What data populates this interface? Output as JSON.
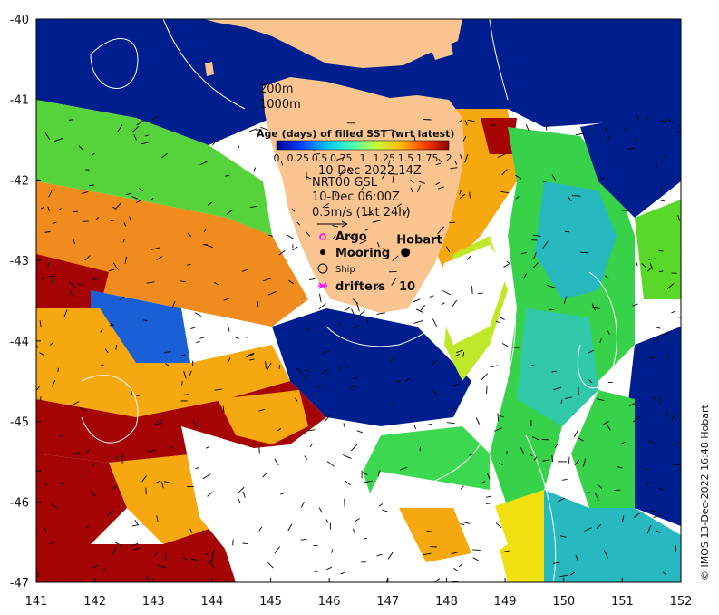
{
  "map": {
    "lon_min": 141,
    "lon_max": 152,
    "lat_min": -47,
    "lat_max": -40,
    "x_ticks": [
      141,
      142,
      143,
      144,
      145,
      146,
      147,
      148,
      149,
      150,
      151,
      152
    ],
    "x_tick_labels": [
      "141",
      "142",
      "143",
      "144",
      "145",
      "146",
      "147",
      "148",
      "149",
      "150",
      "151",
      "152"
    ],
    "y_ticks": [
      -40,
      -41,
      -42,
      -43,
      -44,
      -45,
      -46,
      -47
    ],
    "y_tick_labels": [
      "-40",
      "-41",
      "-42",
      "-43",
      "-44",
      "-45",
      "-46",
      "-47"
    ],
    "land_color": "#f9c48f",
    "ocean_nodata_color": "#ffffff"
  },
  "isobath_labels": {
    "a": "200m",
    "b": "1000m"
  },
  "colorbar": {
    "title": "Age (days) of filled SST (wrt latest)",
    "tick_labels": [
      "0",
      "0.25",
      "0.5",
      "0.75",
      "1",
      "1.25",
      "1.5",
      "1.75",
      "2"
    ],
    "range": [
      0,
      2
    ],
    "colors": [
      "#00008f",
      "#0040ff",
      "#00bfff",
      "#40ffbf",
      "#bfff40",
      "#ffbf00",
      "#ff4000",
      "#8f0000"
    ]
  },
  "info": {
    "date": "10-Dec-2022 14Z",
    "product": "NRT00 GSL",
    "current_time": "10-Dec 06:00Z",
    "scale": "0.5m/s (1kt 24h)"
  },
  "legend": {
    "argo": "Argo",
    "mooring": "Mooring",
    "ship": "Ship",
    "drifters": "drifters",
    "argo_color": "#ff00ff",
    "drifter_color": "#ff00ff"
  },
  "place": {
    "name": "Hobart",
    "lon": 147.3,
    "lat": -42.9
  },
  "drifters_value": "10",
  "credit": "© IMOS 13-Dec-2022 16:48 Hobart"
}
